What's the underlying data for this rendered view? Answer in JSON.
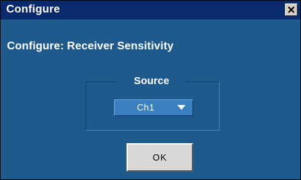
{
  "window": {
    "title": "Configure",
    "close_label": "Close"
  },
  "main": {
    "heading": "Configure: Receiver Sensitivity",
    "source_group": {
      "label": "Source",
      "selected": "Ch1"
    },
    "ok_label": "OK"
  },
  "icons": {
    "close": "close-icon",
    "dropdown": "chevron-down-icon"
  },
  "colors": {
    "titlebar": "#0a2a6e",
    "body": "#1f5a8c",
    "dropdown": "#3a7fc0",
    "button": "#d8d8d8"
  }
}
